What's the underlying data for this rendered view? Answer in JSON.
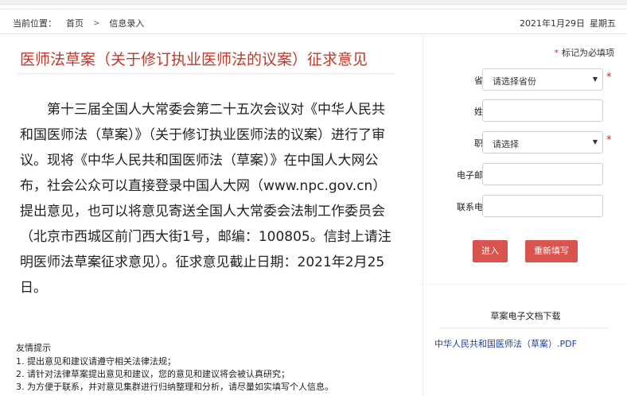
{
  "breadcrumb": {
    "label": "当前位置：",
    "home": "首页",
    "separator": ">",
    "current": "信息录入"
  },
  "date": {
    "date_text": "2021年1月29日",
    "weekday": "星期五"
  },
  "article": {
    "title": "医师法草案（关于修订执业医师法的议案）征求意见",
    "body": "第十三届全国人大常委会第二十五次会议对《中华人民共和国医师法（草案）》（关于修订执业医师法的议案）进行了审议。现将《中华人民共和国医师法（草案）》在中国人大网公布，社会公众可以直接登录中国人大网（www.npc.gov.cn）提出意见，也可以将意见寄送全国人大常委会法制工作委员会（北京市西城区前门西大街1号，邮编：100805。信封上请注明医师法草案征求意见）。征求意见截止日期：2021年2月25日。"
  },
  "tips": {
    "title": "友情提示",
    "items": [
      "1. 提出意见和建议请遵守相关法律法规；",
      "2. 请针对法律草案提出意见和建议，您的意见和建议将会被认真研究；",
      "3. 为方便于联系，并对意见集群进行归纳整理和分析，请尽量如实填写个人信息。"
    ]
  },
  "form": {
    "required_star": "*",
    "required_note": "标记为必填项",
    "province": {
      "label": "省份",
      "value": "请选择省份"
    },
    "name": {
      "label": "姓名",
      "value": ""
    },
    "occupation": {
      "label": "职业",
      "value": "请选择"
    },
    "email": {
      "label": "电子邮件",
      "value": ""
    },
    "phone": {
      "label": "联系电话",
      "value": ""
    },
    "submit_label": "进入",
    "reset_label": "重新填写"
  },
  "download": {
    "title": "草案电子文档下载",
    "link": "中华人民共和国医师法（草案）.PDF"
  }
}
